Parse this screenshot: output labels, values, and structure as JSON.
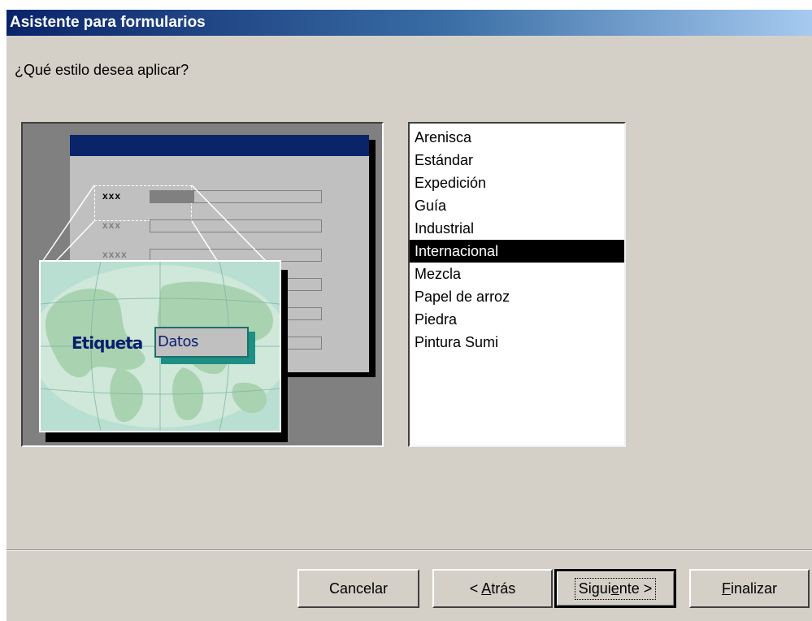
{
  "window": {
    "title": "Asistente para formularios",
    "question": "¿Qué estilo desea aplicar?"
  },
  "preview": {
    "form_labels": [
      "xxx",
      "xxx",
      "xxxx"
    ],
    "sample_label": "Etiqueta",
    "sample_data": "Datos"
  },
  "styles": {
    "items": [
      "Arenisca",
      "Estándar",
      "Expedición",
      "Guía",
      "Industrial",
      "Internacional",
      "Mezcla",
      "Papel de arroz",
      "Piedra",
      "Pintura Sumi"
    ],
    "selected": "Internacional"
  },
  "buttons": {
    "cancel": "Cancelar",
    "back_prefix": "< ",
    "back_mnemonic": "A",
    "back_rest": "trás",
    "next_prefix": "Sigui",
    "next_mnemonic": "e",
    "next_rest": "nte >",
    "finish_mnemonic": "F",
    "finish_rest": "inalizar"
  },
  "colors": {
    "dialog_bg": "#d4d0c8",
    "title_gradient_start": "#0a246a",
    "title_gradient_end": "#a6caf0",
    "selection_bg": "#000000",
    "sample_label_color": "#0a1e6e"
  }
}
